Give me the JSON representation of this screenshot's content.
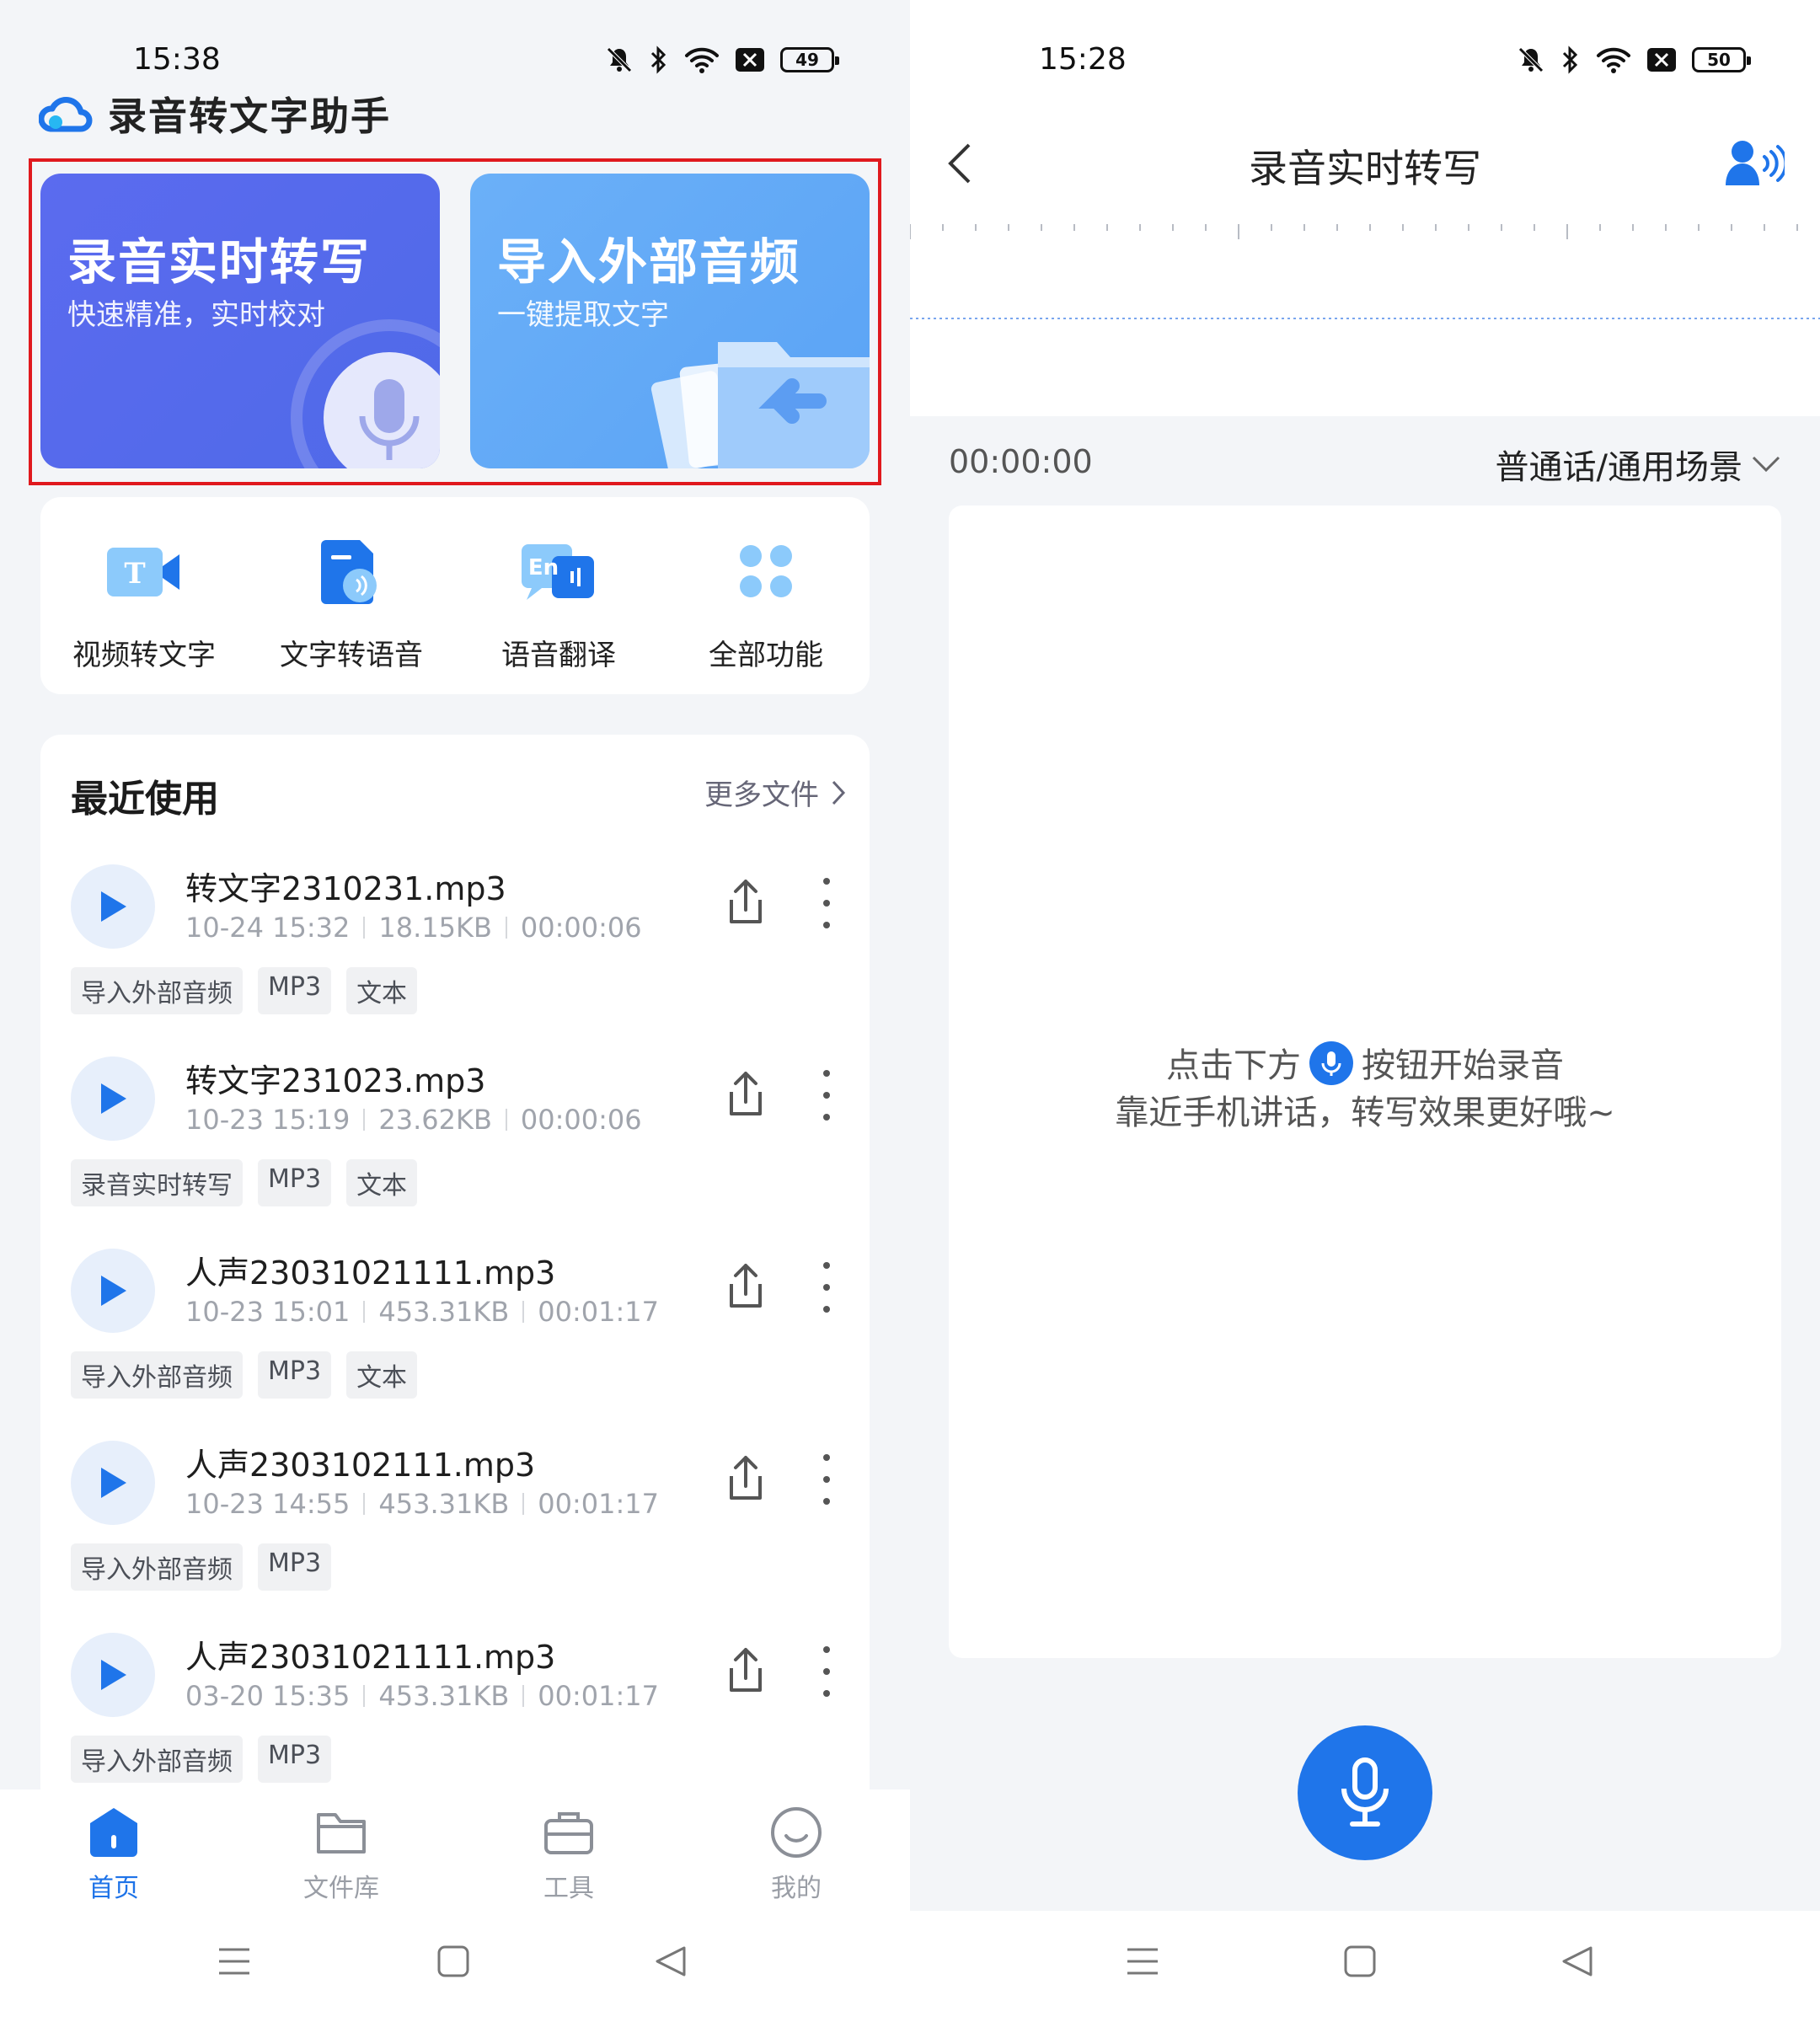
{
  "left": {
    "status": {
      "time": "15:38",
      "battery": "49"
    },
    "app_title": "录音转文字助手",
    "hero_cards": [
      {
        "title": "录音实时转写",
        "subtitle": "快速精准，实时校对",
        "icon": "microphone-icon",
        "color": "#5b6bef"
      },
      {
        "title": "导入外部音频",
        "subtitle": "一键提取文字",
        "icon": "folder-import-icon",
        "color": "#6bb0f8"
      }
    ],
    "quick_actions": [
      {
        "label": "视频转文字",
        "icon": "video-to-text-icon"
      },
      {
        "label": "文字转语音",
        "icon": "text-to-speech-icon"
      },
      {
        "label": "语音翻译",
        "icon": "voice-translate-icon"
      },
      {
        "label": "全部功能",
        "icon": "all-functions-icon"
      }
    ],
    "recent": {
      "title": "最近使用",
      "more": "更多文件",
      "files": [
        {
          "name": "转文字2310231.mp3",
          "date": "10-24 15:32",
          "size": "18.15KB",
          "duration": "00:00:06",
          "tags": [
            "导入外部音频",
            "MP3",
            "文本"
          ]
        },
        {
          "name": "转文字231023.mp3",
          "date": "10-23 15:19",
          "size": "23.62KB",
          "duration": "00:00:06",
          "tags": [
            "录音实时转写",
            "MP3",
            "文本"
          ]
        },
        {
          "name": "人声23031021111.mp3",
          "date": "10-23 15:01",
          "size": "453.31KB",
          "duration": "00:01:17",
          "tags": [
            "导入外部音频",
            "MP3",
            "文本"
          ]
        },
        {
          "name": "人声2303102111.mp3",
          "date": "10-23 14:55",
          "size": "453.31KB",
          "duration": "00:01:17",
          "tags": [
            "导入外部音频",
            "MP3"
          ]
        },
        {
          "name": "人声23031021111.mp3",
          "date": "03-20 15:35",
          "size": "453.31KB",
          "duration": "00:01:17",
          "tags": [
            "导入外部音频",
            "MP3"
          ]
        }
      ]
    },
    "tabs": [
      {
        "label": "首页",
        "icon": "home-icon",
        "active": true
      },
      {
        "label": "文件库",
        "icon": "folder-icon",
        "active": false
      },
      {
        "label": "工具",
        "icon": "toolbox-icon",
        "active": false
      },
      {
        "label": "我的",
        "icon": "profile-icon",
        "active": false
      }
    ]
  },
  "right": {
    "status": {
      "time": "15:28",
      "battery": "50"
    },
    "page_title": "录音实时转写",
    "timer": "00:00:00",
    "scene": "普通话/通用场景",
    "hint_line1_a": "点击下方",
    "hint_line1_b": "按钮开始录音",
    "hint_line2": "靠近手机讲话，转写效果更好哦~"
  },
  "colors": {
    "accent": "#1f75ea",
    "highlight_border": "#e0191e",
    "background": "#f3f5f8"
  }
}
